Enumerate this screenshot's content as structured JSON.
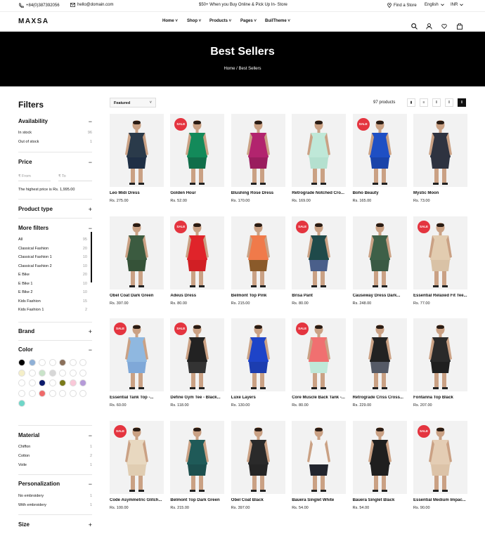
{
  "topbar": {
    "phone": "+84(0)387392056",
    "email": "hello@domain.com",
    "promo": "$50+ When you Buy Online & Pick Up In- Store",
    "store": "Find a Store",
    "language": "English",
    "currency": "INR"
  },
  "header": {
    "logo": "MAXSA",
    "nav": [
      "Home",
      "Shop",
      "Products",
      "Pages",
      "BuilTheme"
    ]
  },
  "hero": {
    "title": "Best Sellers",
    "breadcrumb": [
      "Home",
      "/",
      "Best Sellers"
    ]
  },
  "filters": {
    "title": "Filters",
    "availability": {
      "label": "Availability",
      "items": [
        {
          "label": "In stock",
          "count": "96"
        },
        {
          "label": "Out of stock",
          "count": "1"
        }
      ]
    },
    "price": {
      "label": "Price",
      "from": "₹  From",
      "to": "₹  To",
      "note": "The highest price is Rs. 1,995.00"
    },
    "product_type": {
      "label": "Product type"
    },
    "more": {
      "label": "More filters",
      "items": [
        {
          "label": "All",
          "count": "95"
        },
        {
          "label": "Classical Fashion",
          "count": "20"
        },
        {
          "label": "Classical Fashion 1",
          "count": "10"
        },
        {
          "label": "Classical Fashion 2",
          "count": "10"
        },
        {
          "label": "E Bike",
          "count": "20"
        },
        {
          "label": "E Bike 1",
          "count": "10"
        },
        {
          "label": "E Bike 2",
          "count": "10"
        },
        {
          "label": "Kids Fashion",
          "count": "15"
        },
        {
          "label": "Kids Fashion 1",
          "count": "2"
        }
      ]
    },
    "brand": {
      "label": "Brand"
    },
    "color": {
      "label": "Color",
      "swatches": [
        "#000000",
        "#8fb0d6",
        "#ffffff",
        "#ffffff",
        "#8a6f5a",
        "#ffffff",
        "#ffffff",
        "#f5efc8",
        "#ffffff",
        "#c9e3c9",
        "#d7d7d7",
        "#ffffff",
        "#ffffff",
        "#ffffff",
        "#ffffff",
        "#ffffff",
        "#0b1a6b",
        "#ffffff",
        "#7a7a1a",
        "#f9c8d8",
        "#b59ad8",
        "#ffffff",
        "#ffffff",
        "#ef6a6a",
        "#ffffff",
        "#ffffff",
        "#ffffff",
        "#ffffff",
        "#6fd6c8"
      ]
    },
    "material": {
      "label": "Material",
      "items": [
        {
          "label": "Chiffon",
          "count": "1"
        },
        {
          "label": "Cotton",
          "count": "2"
        },
        {
          "label": "Voile",
          "count": "1"
        }
      ]
    },
    "personalization": {
      "label": "Personalization",
      "items": [
        {
          "label": "No embroidery",
          "count": "1"
        },
        {
          "label": "With embroidery",
          "count": "1"
        }
      ]
    },
    "size": {
      "label": "Size"
    }
  },
  "toolbar": {
    "sort": "Featured",
    "count": "97 products"
  },
  "products": [
    {
      "name": "Leo Midi Dress",
      "price": "Rs. 275.00",
      "sale": false,
      "top": "#2a3a4a",
      "bottom": "#1f2f45"
    },
    {
      "name": "Golden Hour",
      "price": "Rs. 52.00",
      "sale": true,
      "top": "#138a5a",
      "bottom": "#116e4a"
    },
    {
      "name": "Blushing Rose Dress",
      "price": "Rs. 170.00",
      "sale": false,
      "top": "#b2246e",
      "bottom": "#9a1d5e"
    },
    {
      "name": "Retrograde Notched Cro...",
      "price": "Rs. 169.00",
      "sale": false,
      "top": "#bfe8d8",
      "bottom": "#b4e0cf"
    },
    {
      "name": "Boho Beauty",
      "price": "Rs. 165.00",
      "sale": true,
      "top": "#1f4fc4",
      "bottom": "#1a44aa"
    },
    {
      "name": "Mystic Moon",
      "price": "Rs. 73.00",
      "sale": false,
      "top": "#2e3340",
      "bottom": "#2e3340"
    },
    {
      "name": "Obel Coat Dark Green",
      "price": "Rs. 397.00",
      "sale": false,
      "top": "#3b5b40",
      "bottom": "#355238"
    },
    {
      "name": "Adeus Dress",
      "price": "Rs. 80.00",
      "sale": true,
      "top": "#e0242a",
      "bottom": "#d11f24"
    },
    {
      "name": "Belmont Top Pink",
      "price": "Rs. 215.00",
      "sale": false,
      "top": "#f07a4a",
      "bottom": "#8a5a2a"
    },
    {
      "name": "Brisa Pant",
      "price": "Rs. 80.00",
      "sale": true,
      "top": "#1f4a4a",
      "bottom": "#4a5f8a"
    },
    {
      "name": "Causeway Dress Dark...",
      "price": "Rs. 248.00",
      "sale": false,
      "top": "#3e6048",
      "bottom": "#3a5a44"
    },
    {
      "name": "Essential Relaxed Fit Tee...",
      "price": "Rs. 77.00",
      "sale": true,
      "top": "#e2ccb0",
      "bottom": "#d9c2a6"
    },
    {
      "name": "Essential Tank Top -...",
      "price": "Rs. 60.00",
      "sale": true,
      "top": "#8fb8e0",
      "bottom": "#7fa8d8"
    },
    {
      "name": "Define Gym Tee - Black...",
      "price": "Rs. 118.00",
      "sale": true,
      "top": "#222222",
      "bottom": "#333333"
    },
    {
      "name": "Luxe Layers",
      "price": "Rs. 130.00",
      "sale": false,
      "top": "#1e44c8",
      "bottom": "#1c3db0"
    },
    {
      "name": "Core Muscle Back Tank -...",
      "price": "Rs. 80.00",
      "sale": true,
      "top": "#f07070",
      "bottom": "#bfe8d8"
    },
    {
      "name": "Retrograde Criss Cross...",
      "price": "Rs. 229.00",
      "sale": false,
      "top": "#222222",
      "bottom": "#555a66"
    },
    {
      "name": "Fontanna Top Black",
      "price": "Rs. 207.00",
      "sale": false,
      "top": "#2a2a2a",
      "bottom": "#1f1f1f"
    },
    {
      "name": "Code Asymmetric Glitch...",
      "price": "Rs. 100.00",
      "sale": true,
      "top": "#e8d8c0",
      "bottom": "#e0cdb2"
    },
    {
      "name": "Belmont Top Dark Green",
      "price": "Rs. 215.00",
      "sale": false,
      "top": "#1f5a58",
      "bottom": "#1c4f4e"
    },
    {
      "name": "Obel Coat Black",
      "price": "Rs. 397.00",
      "sale": false,
      "top": "#2a2a2a",
      "bottom": "#252525"
    },
    {
      "name": "Bauera Singlet White",
      "price": "Rs. 54.00",
      "sale": false,
      "top": "#f4f4f4",
      "bottom": "#22252e"
    },
    {
      "name": "Bauera Singlet Black",
      "price": "Rs. 54.00",
      "sale": false,
      "top": "#1f1f1f",
      "bottom": "#1f1f1f"
    },
    {
      "name": "Essential Medium Impac...",
      "price": "Rs. 90.00",
      "sale": true,
      "top": "#e4cdb4",
      "bottom": "#dcc3a8"
    }
  ],
  "sale_label": "SALE"
}
